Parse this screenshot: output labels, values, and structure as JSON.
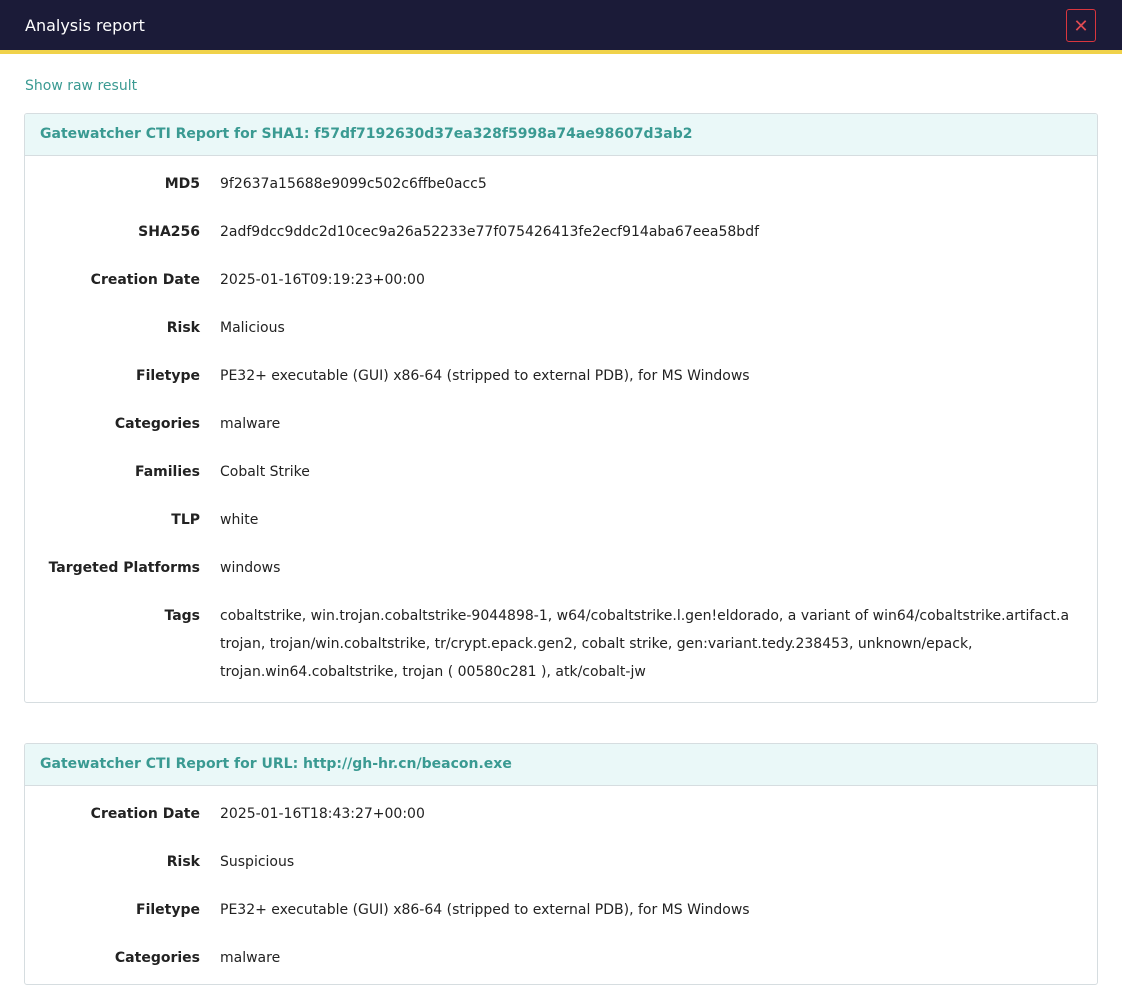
{
  "modal": {
    "title": "Analysis report",
    "close_label": "✕",
    "raw_link": "Show raw result"
  },
  "colors": {
    "header_bg": "#1b1b38",
    "header_accent": "#f0d24a",
    "link": "#3a9a92",
    "close": "#d9363e",
    "card_header_bg": "#eaf8f8"
  },
  "reports": [
    {
      "title": "Gatewatcher CTI Report for SHA1: f57df7192630d37ea328f5998a74ae98607d3ab2",
      "fields": [
        {
          "label": "MD5",
          "value": "9f2637a15688e9099c502c6ffbe0acc5"
        },
        {
          "label": "SHA256",
          "value": "2adf9dcc9ddc2d10cec9a26a52233e77f075426413fe2ecf914aba67eea58bdf"
        },
        {
          "label": "Creation Date",
          "value": "2025-01-16T09:19:23+00:00"
        },
        {
          "label": "Risk",
          "value": "Malicious"
        },
        {
          "label": "Filetype",
          "value": "PE32+ executable (GUI) x86-64 (stripped to external PDB), for MS Windows"
        },
        {
          "label": "Categories",
          "value": "malware"
        },
        {
          "label": "Families",
          "value": "Cobalt Strike"
        },
        {
          "label": "TLP",
          "value": "white"
        },
        {
          "label": "Targeted Platforms",
          "value": "windows"
        },
        {
          "label": "Tags",
          "value": "cobaltstrike, win.trojan.cobaltstrike-9044898-1, w64/cobaltstrike.l.gen!eldorado, a variant of win64/cobaltstrike.artifact.a trojan, trojan/win.cobaltstrike, tr/crypt.epack.gen2, cobalt strike, gen:variant.tedy.238453, unknown/epack, trojan.win64.cobaltstrike, trojan ( 00580c281 ), atk/cobalt-jw"
        }
      ]
    },
    {
      "title": "Gatewatcher CTI Report for URL: http://gh-hr.cn/beacon.exe",
      "fields": [
        {
          "label": "Creation Date",
          "value": "2025-01-16T18:43:27+00:00"
        },
        {
          "label": "Risk",
          "value": "Suspicious"
        },
        {
          "label": "Filetype",
          "value": "PE32+ executable (GUI) x86-64 (stripped to external PDB), for MS Windows"
        },
        {
          "label": "Categories",
          "value": "malware"
        }
      ]
    }
  ]
}
